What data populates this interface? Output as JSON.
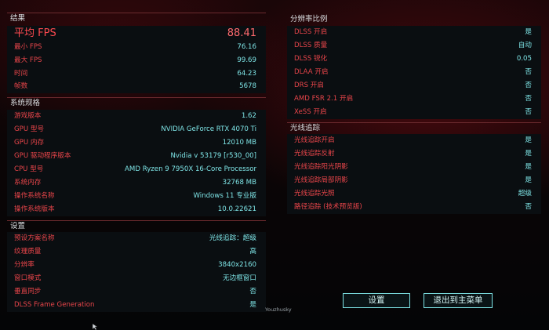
{
  "results": {
    "title": "结果",
    "rows": [
      {
        "label": "平均 FPS",
        "value": "88.41"
      },
      {
        "label": "最小 FPS",
        "value": "76.16"
      },
      {
        "label": "最大 FPS",
        "value": "99.69"
      },
      {
        "label": "时间",
        "value": "64.23"
      },
      {
        "label": "帧数",
        "value": "5678"
      }
    ]
  },
  "system": {
    "title": "系统规格",
    "rows": [
      {
        "label": "游戏版本",
        "value": "1.62"
      },
      {
        "label": "GPU 型号",
        "value": "NVIDIA GeForce RTX 4070 Ti"
      },
      {
        "label": "GPU 内存",
        "value": "12010 MB"
      },
      {
        "label": "GPU 驱动程序版本",
        "value": "Nvidia v 53179 [r530_00]"
      },
      {
        "label": "CPU 型号",
        "value": "AMD Ryzen 9 7950X 16-Core Processor"
      },
      {
        "label": "系统内存",
        "value": "32768 MB"
      },
      {
        "label": "操作系统名称",
        "value": "Windows 11 专业版"
      },
      {
        "label": "操作系统版本",
        "value": "10.0.22621"
      }
    ]
  },
  "settings": {
    "title": "设置",
    "rows": [
      {
        "label": "预设方案名称",
        "value": "光线追踪：超级"
      },
      {
        "label": "纹理质量",
        "value": "高"
      },
      {
        "label": "分辨率",
        "value": "3840x2160"
      },
      {
        "label": "窗口模式",
        "value": "无边框窗口"
      },
      {
        "label": "垂直同步",
        "value": "否"
      },
      {
        "label": "DLSS Frame Generation",
        "value": "是"
      }
    ]
  },
  "resolution_scaling": {
    "title": "分辨率比例",
    "rows": [
      {
        "label": "DLSS 开启",
        "value": "是"
      },
      {
        "label": "DLSS 质量",
        "value": "自动"
      },
      {
        "label": "DLSS 锐化",
        "value": "0.05"
      },
      {
        "label": "DLAA 开启",
        "value": "否"
      },
      {
        "label": "DRS 开启",
        "value": "否"
      },
      {
        "label": "AMD FSR 2.1 开启",
        "value": "否"
      },
      {
        "label": "XeSS 开启",
        "value": "否"
      }
    ]
  },
  "ray_tracing": {
    "title": "光线追踪",
    "rows": [
      {
        "label": "光线追踪开启",
        "value": "是"
      },
      {
        "label": "光线追踪反射",
        "value": "是"
      },
      {
        "label": "光线追踪阳光阴影",
        "value": "是"
      },
      {
        "label": "光线追踪局部阴影",
        "value": "是"
      },
      {
        "label": "光线追踪光照",
        "value": "超级"
      },
      {
        "label": "路径追踪 (技术预览版)",
        "value": "否"
      }
    ]
  },
  "buttons": {
    "settings": "设置",
    "exit": "退出到主菜单"
  },
  "signature": "Youzhusky",
  "colors": {
    "label": "#e8454a",
    "value": "#7ee4e6",
    "accent": "#ff4a50"
  }
}
